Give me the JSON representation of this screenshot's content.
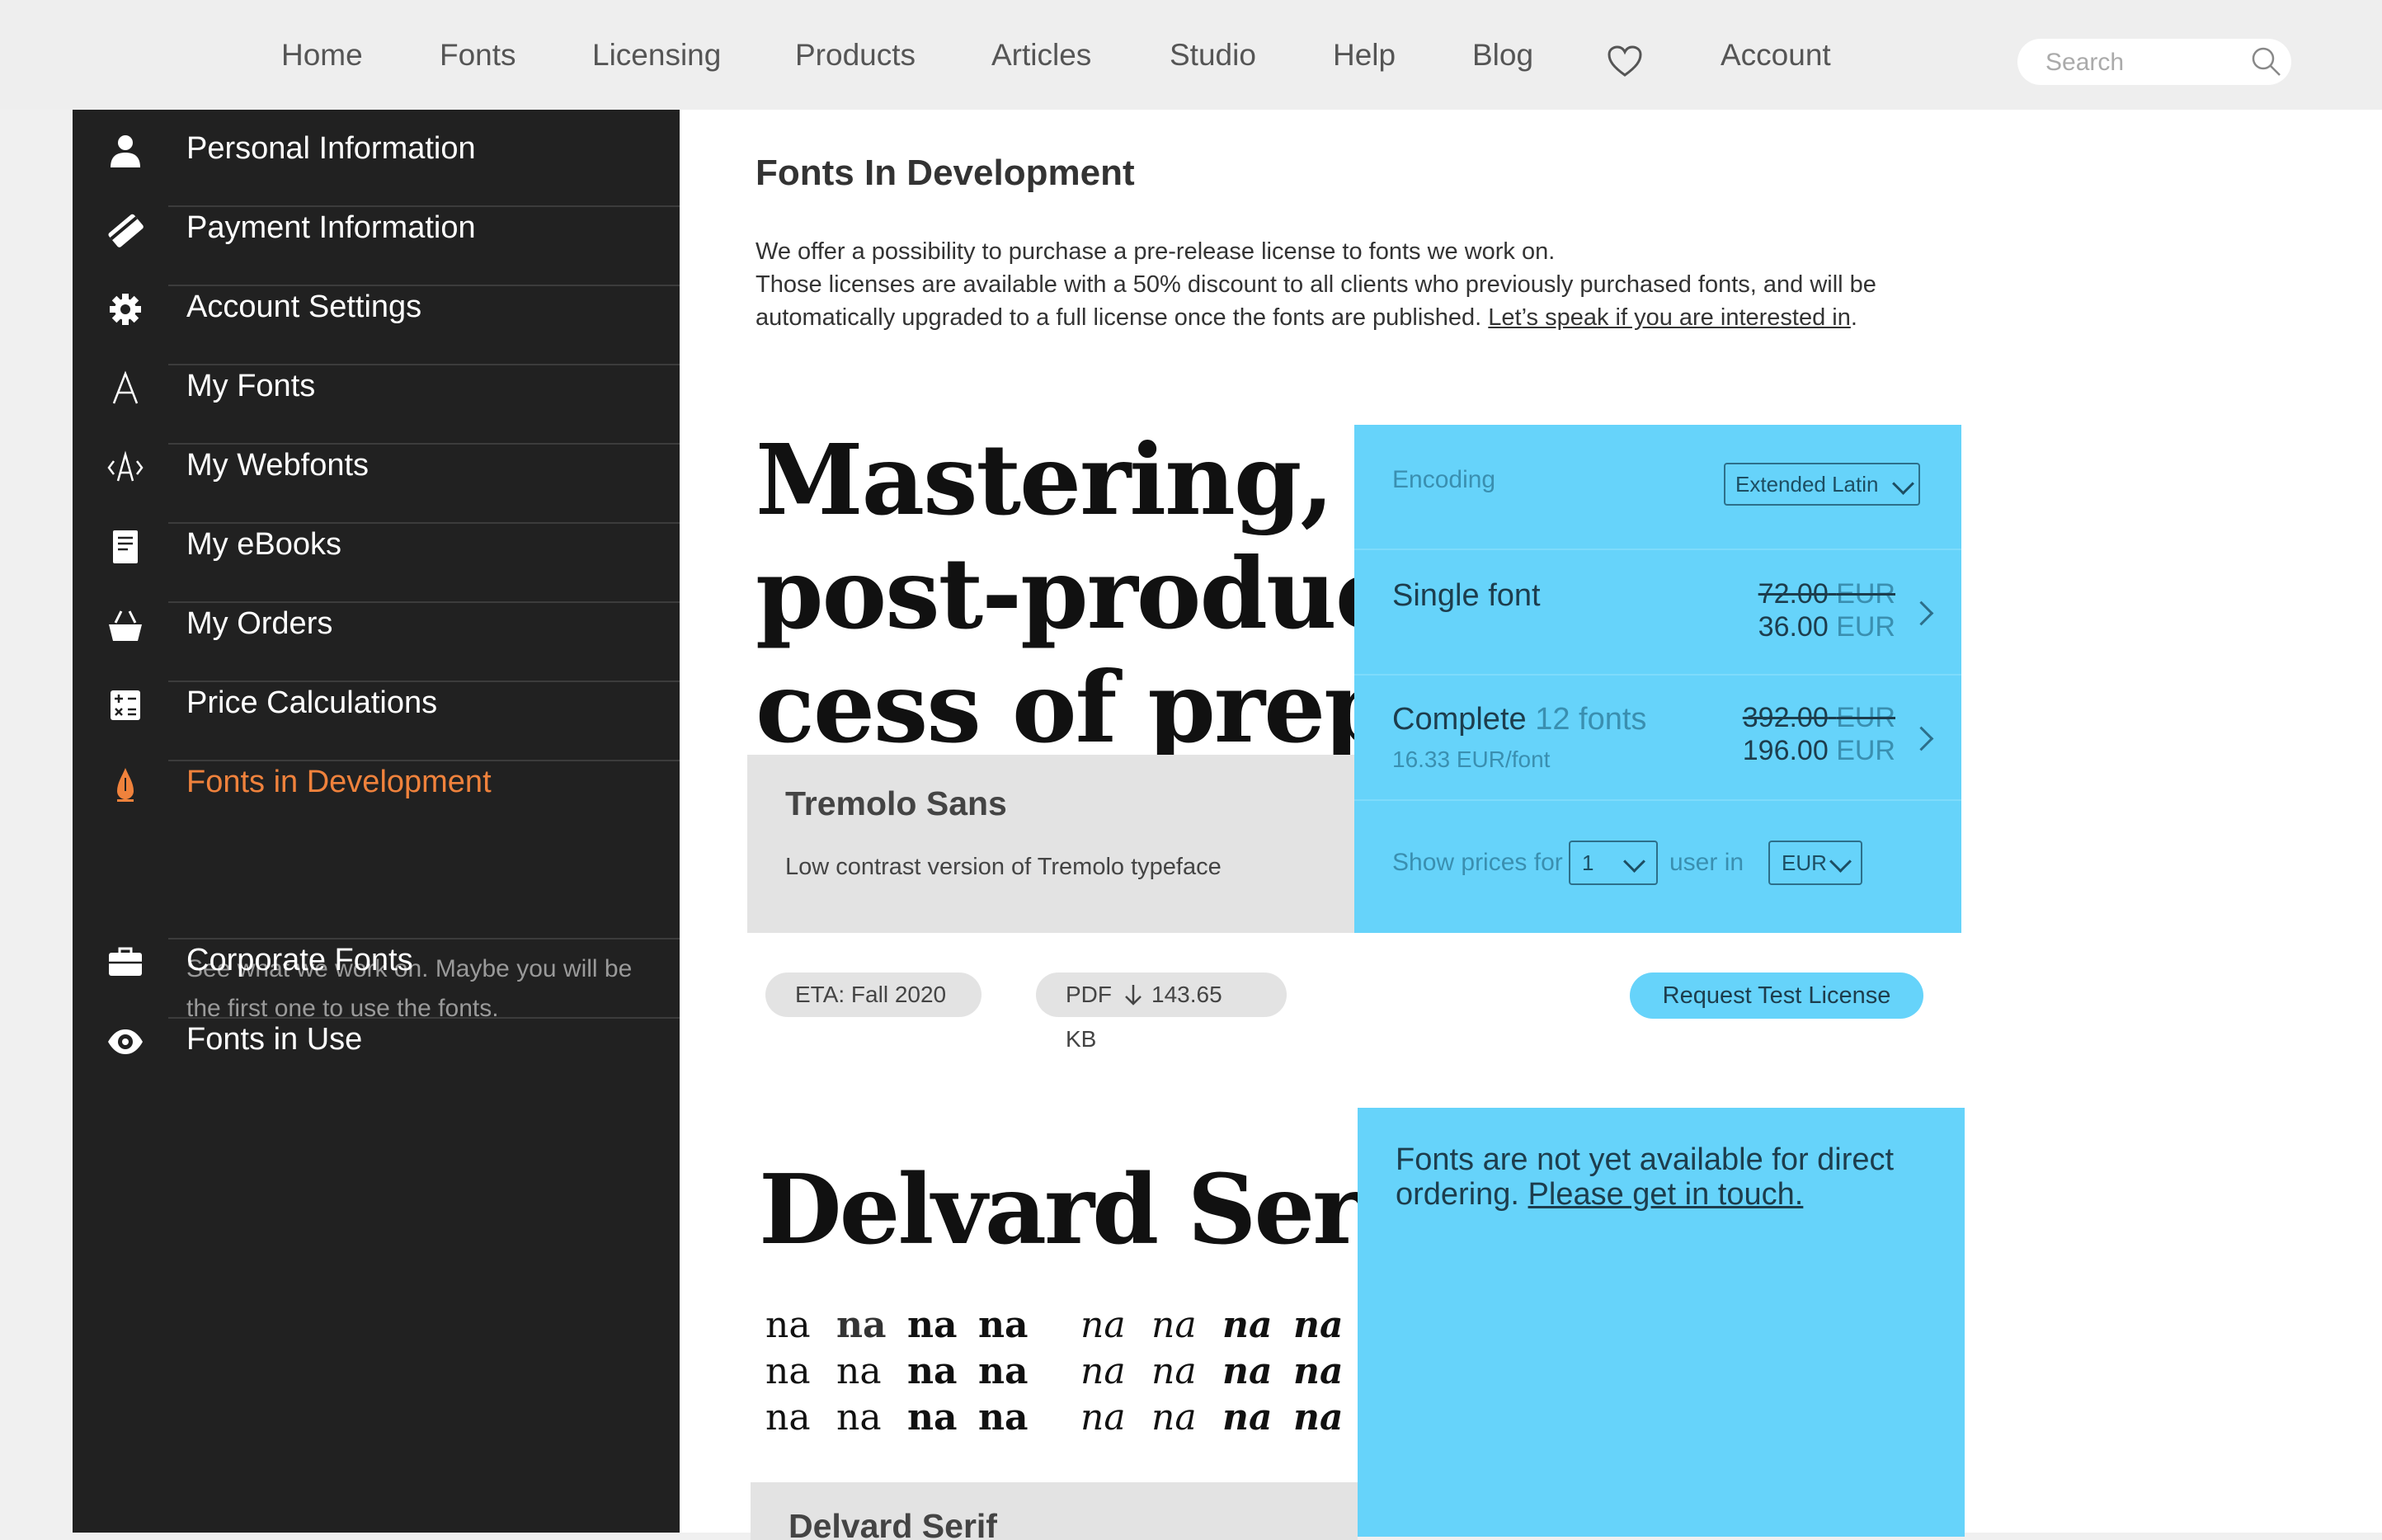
{
  "nav": {
    "items": [
      {
        "label": "Home"
      },
      {
        "label": "Fonts"
      },
      {
        "label": "Licensing"
      },
      {
        "label": "Products"
      },
      {
        "label": "Articles"
      },
      {
        "label": "Studio"
      },
      {
        "label": "Help"
      },
      {
        "label": "Blog"
      },
      {
        "label": "Account"
      }
    ],
    "favorites_icon": "heart-icon",
    "search": {
      "placeholder": "Search",
      "value": "",
      "icon": "search-icon"
    }
  },
  "sidebar": {
    "items": [
      {
        "label": "Personal Information",
        "icon": "user-icon"
      },
      {
        "label": "Payment Information",
        "icon": "card-icon"
      },
      {
        "label": "Account Settings",
        "icon": "gear-icon"
      },
      {
        "label": "My Fonts",
        "icon": "letter-a-icon"
      },
      {
        "label": "My Webfonts",
        "icon": "webfont-icon"
      },
      {
        "label": "My eBooks",
        "icon": "ebook-icon"
      },
      {
        "label": "My Orders",
        "icon": "basket-icon"
      },
      {
        "label": "Price Calculations",
        "icon": "calculator-icon"
      },
      {
        "label": "Fonts in Development",
        "icon": "pen-nib-icon",
        "active": true,
        "description": "See what we work on. Maybe you will be the first one to use the fonts."
      },
      {
        "label": "Corporate Fonts",
        "icon": "briefcase-icon"
      },
      {
        "label": "Fonts in Use",
        "icon": "eye-icon"
      }
    ],
    "active_color": "#f0823c"
  },
  "main": {
    "title": "Fonts In Development",
    "intro_line1": "We offer a possibility to purchase a pre-release license to fonts we work on.",
    "intro_line2": "Those licenses are available with a 50% discount to all clients who previously purchased fonts, and will be automatically upgraded to a full license once the fonts are published.",
    "intro_link": "Let’s speak if you are interested in",
    "intro_end": "."
  },
  "card1": {
    "specimen_lines": [
      "Mastering, a font",
      "post-production",
      "cess of preparing"
    ],
    "name": "Tremolo Sans",
    "description": "Low contrast version of Tremolo typeface",
    "encoding_label": "Encoding",
    "encoding_value": "Extended Latin",
    "single": {
      "title": "Single font",
      "old_price": "72.00",
      "new_price": "36.00",
      "currency": "EUR"
    },
    "complete": {
      "title": "Complete",
      "count": "12 fonts",
      "per_font": "16.33 EUR/font",
      "old_price": "392.00",
      "new_price": "196.00",
      "currency": "EUR"
    },
    "show_prices_for": "Show prices for",
    "users_value": "1",
    "user_in": "user in",
    "currency_value": "EUR",
    "eta": "ETA: Fall 2020",
    "pdf_label": "PDF",
    "pdf_size": "143.65 KB",
    "request_button": "Request Test License",
    "panel_color": "#66d3fa"
  },
  "card2": {
    "title": "Delvard Serif",
    "sample": "na",
    "name": "Delvard Serif",
    "note": "Fonts are not yet available for direct ordering.",
    "note_link": "Please get in touch."
  }
}
